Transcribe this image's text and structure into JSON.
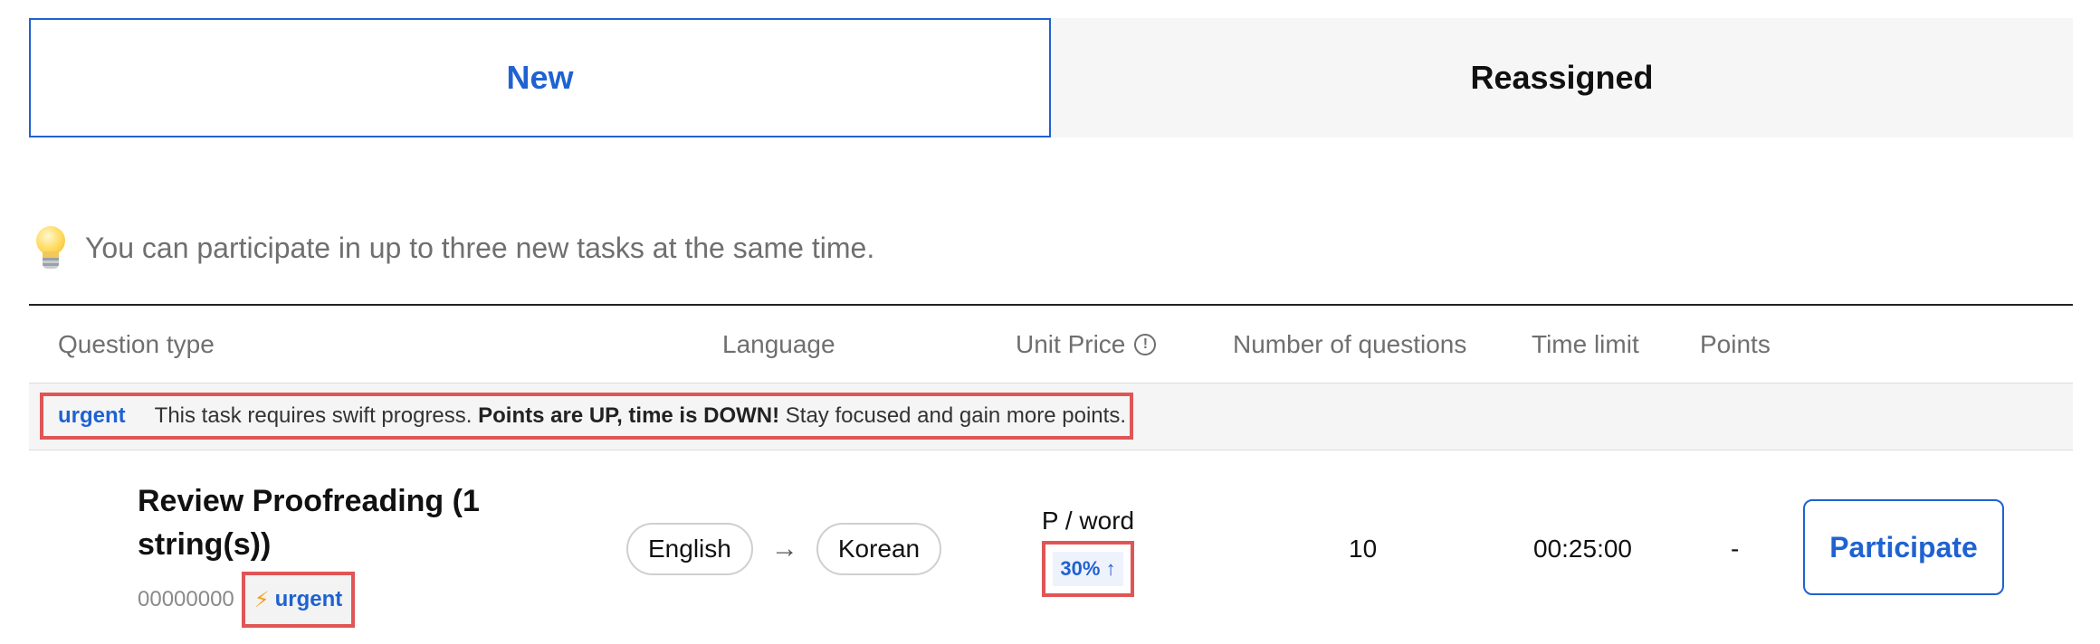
{
  "tabs": [
    {
      "label": "New",
      "active": true
    },
    {
      "label": "Reassigned",
      "active": false
    }
  ],
  "notice": {
    "icon": "lightbulb-icon",
    "text": "You can participate in up to three new tasks at the same time."
  },
  "table": {
    "headers": {
      "question_type": "Question type",
      "language": "Language",
      "unit_price": "Unit Price",
      "num_questions": "Number of questions",
      "time_limit": "Time limit",
      "points": "Points"
    },
    "banner": {
      "tag": "urgent",
      "text_before": "This task requires swift progress. ",
      "text_bold": "Points are UP, time is DOWN!",
      "text_after": " Stay focused and gain more points."
    },
    "rows": [
      {
        "title": "Review Proofreading (1 string(s))",
        "id": "00000000",
        "badge": "urgent",
        "source_lang": "English",
        "target_lang": "Korean",
        "price_unit": "P / word",
        "price_boost": "30% ↑",
        "num_questions": "10",
        "time_limit": "00:25:00",
        "points": "-",
        "action": "Participate"
      }
    ]
  },
  "colors": {
    "accent": "#1f62d1",
    "highlight_border": "#e05555",
    "muted_text": "#6f6f6f"
  }
}
